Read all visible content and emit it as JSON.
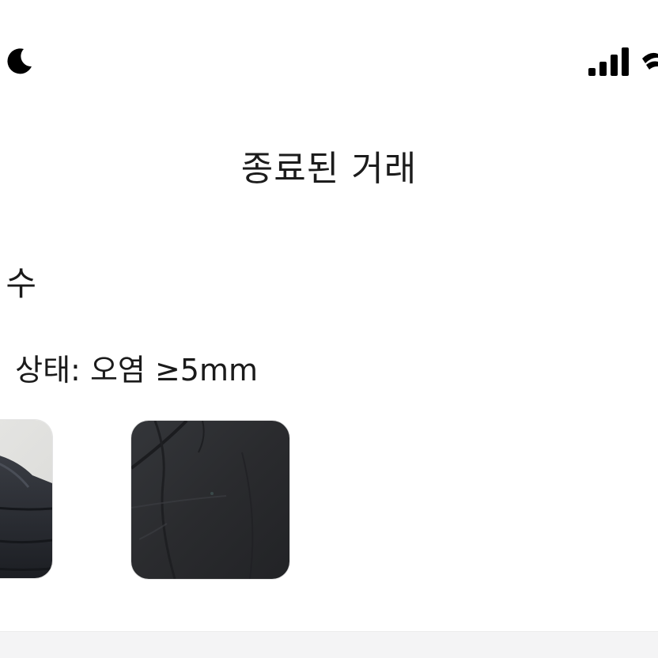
{
  "status_bar": {
    "left_icons": [
      "moon-icon"
    ],
    "right_icons": [
      "signal-icon",
      "wifi-icon"
    ]
  },
  "header": {
    "title": "종료된 거래"
  },
  "item": {
    "title_visible": "수",
    "condition_visible": "상태: 오염 ≥5mm",
    "photos": [
      {
        "name": "jacket-front-photo"
      },
      {
        "name": "jacket-closeup-photo"
      }
    ]
  },
  "colors": {
    "background": "#ffffff",
    "text": "#1c1c1c",
    "bottom_bar": "#f4f4f5",
    "photo_dark": "#2a2b2e"
  }
}
